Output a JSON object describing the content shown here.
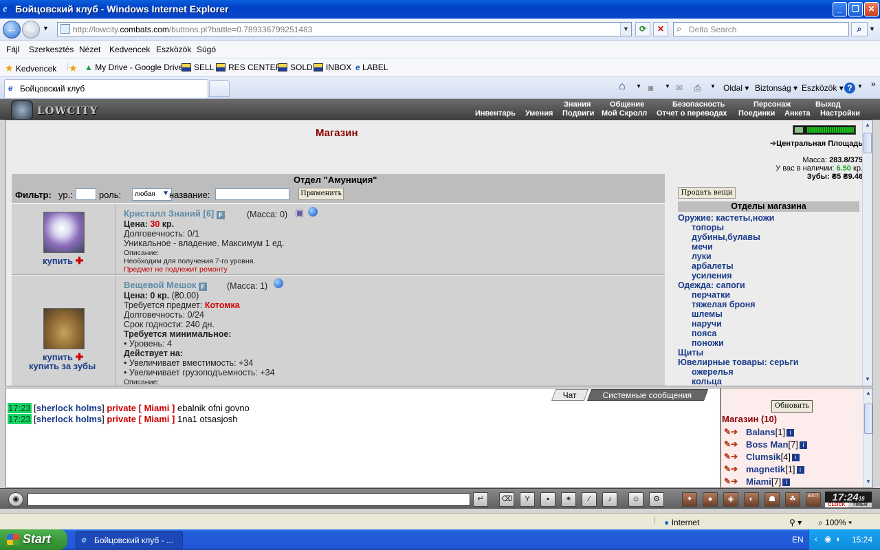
{
  "window": {
    "title": "Бойцовский клуб - Windows Internet Explorer",
    "minimize": "_",
    "maximize": "❐",
    "close": "✕"
  },
  "address": {
    "url_prefix": "http://lowcity.",
    "url_domain": "combats.com",
    "url_rest": "/buttons.pl?battle=0.789336799251483",
    "search_placeholder": "Delta Search"
  },
  "menu": {
    "file": "Fájl",
    "edit": "Szerkesztés",
    "view": "Nézet",
    "favorites": "Kedvencek",
    "tools": "Eszközök",
    "help": "Súgó"
  },
  "favbar": {
    "favorites": "Kedvencek",
    "items": [
      "My Drive - Google Drive",
      "SELL",
      "RES CENTER",
      "SOLD",
      "INBOX",
      "LABEL"
    ]
  },
  "tab": {
    "active_label": "Бойцовский клуб"
  },
  "commandbar": {
    "page": "Oldal",
    "safety": "Biztonság",
    "tools": "Eszközök"
  },
  "game": {
    "logo_text": "LOWCITY",
    "top_menu": [
      "Знания",
      "Общение",
      "Безопасность",
      "Персонаж",
      "Выход"
    ],
    "sub_menu": [
      "Инвентарь",
      "Умения",
      "Подвиги",
      "Мой Скролл",
      "Отчет о переводах",
      "Поединки",
      "Анкета",
      "Настройки"
    ],
    "shop_title": "Магазин",
    "department": "Отдел \"Амуниция\"",
    "filter": {
      "label": "Фильтр:",
      "level_label": "ур.:",
      "role_label": "роль:",
      "role_value": "любая",
      "name_label": "название:",
      "apply": "Применить"
    },
    "items": [
      {
        "name": "Кристалл Знаний [6]",
        "mass": "(Масса: 0)",
        "price_label": "Цена:",
        "price_value": "30",
        "price_unit": "кр.",
        "durability": "Долговечность: 0/1",
        "unique": "Уникальное - владение. Максимум 1 ед.",
        "desc_label": "Описание:",
        "desc": "Необходим для получения 7-го уровня.",
        "no_repair": "Предмет не подлежит ремонту",
        "buy": "купить"
      },
      {
        "name": "Вещевой Мешок",
        "mass": "(Масса: 1)",
        "price_label": "Цена:",
        "price_value": "0 кр.",
        "price_extra": "(₴0.00)",
        "requires_item_label": "Требуется предмет:",
        "requires_item": "Котомка",
        "durability": "Долговечность: 0/24",
        "shelf_life": "Срок годности: 240 дн.",
        "min_req_label": "Требуется минимальное:",
        "min_level": "• Уровень: 4",
        "affects_label": "Действует на:",
        "affect1": "• Увеличивает вместимость: +34",
        "affect2": "• Увеличивает грузоподъемность: +34",
        "desc_label": "Описание:",
        "buy": "купить",
        "buy_teeth": "купить за зубы"
      }
    ],
    "right": {
      "location": "Центральная Площадь",
      "mass_label": "Масса:",
      "mass_value": "283.8/375",
      "cash_label": "У вас в наличии:",
      "cash_value": "6.50",
      "cash_unit": "кр.",
      "teeth_label": "Зубы:",
      "teeth_value": "₴5 ₴9.46",
      "sell_button": "Продать вещи",
      "depts_header": "Отделы магазина",
      "depts": [
        {
          "label": "Оружие: кастеты,ножи",
          "indent": false
        },
        {
          "label": "топоры",
          "indent": true
        },
        {
          "label": "дубины,булавы",
          "indent": true
        },
        {
          "label": "мечи",
          "indent": true
        },
        {
          "label": "луки",
          "indent": true
        },
        {
          "label": "арбалеты",
          "indent": true
        },
        {
          "label": "усиления",
          "indent": true
        },
        {
          "label": "Одежда: сапоги",
          "indent": false
        },
        {
          "label": "перчатки",
          "indent": true
        },
        {
          "label": "тяжелая броня",
          "indent": true
        },
        {
          "label": "шлемы",
          "indent": true
        },
        {
          "label": "наручи",
          "indent": true
        },
        {
          "label": "пояса",
          "indent": true
        },
        {
          "label": "поножи",
          "indent": true
        },
        {
          "label": "Щиты",
          "indent": false
        },
        {
          "label": "Ювелирные товары: серьги",
          "indent": false
        },
        {
          "label": "ожерелья",
          "indent": true
        },
        {
          "label": "кольца",
          "indent": true
        }
      ]
    },
    "chat": {
      "tab_chat": "Чат",
      "tab_system": "Системные сообщения",
      "lines": [
        {
          "time": "17:23",
          "user": "sherlock holms",
          "private": "private [ Miami ]",
          "text": "ebalnik ofni govno"
        },
        {
          "time": "17:23",
          "user": "sherlock holms",
          "private": "private [ Miami ]",
          "text": "1na1 otsasjosh"
        }
      ]
    },
    "online": {
      "refresh": "Обновить",
      "header": "Магазин (10)",
      "users": [
        {
          "name": "Balans",
          "level": "[1]"
        },
        {
          "name": "Boss Man",
          "level": "[7]"
        },
        {
          "name": "Clumsik",
          "level": "[4]"
        },
        {
          "name": "magnetik",
          "level": "[1]"
        },
        {
          "name": "Miami",
          "level": "[7]"
        }
      ]
    },
    "clock": "17:24",
    "clock_sec": "18",
    "clock_label": "CLOCK",
    "timer_label": "TIMER",
    "exit_label": "EXIT"
  },
  "status": {
    "zone": "Internet",
    "zoom": "100%"
  },
  "taskbar": {
    "start": "Start",
    "item": "Бойцовский клуб - ...",
    "lang": "EN",
    "time": "15:24"
  }
}
